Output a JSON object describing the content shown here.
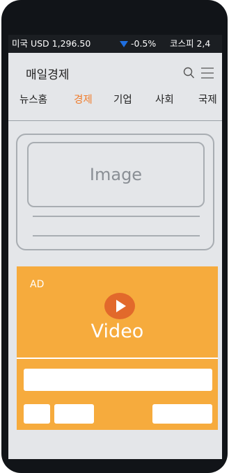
{
  "ticker": {
    "label": "미국 USD 1,296.50",
    "change": "-0.5%",
    "index_label": "코스피 2,4"
  },
  "header": {
    "title": "매일경제"
  },
  "nav": {
    "items": [
      {
        "label": "뉴스홈"
      },
      {
        "label": "경제"
      },
      {
        "label": "기업"
      },
      {
        "label": "사회"
      },
      {
        "label": "국제"
      }
    ],
    "active": "경제"
  },
  "article": {
    "image_placeholder": "Image"
  },
  "ad": {
    "label": "AD",
    "video_label": "Video"
  },
  "colors": {
    "accent": "#f07c2c",
    "ad_background": "#f6ab3d",
    "play_button": "#e2692b",
    "down_indicator": "#1f6fe0"
  },
  "icons": [
    "search-icon",
    "menu-icon",
    "down-triangle-icon",
    "play-icon"
  ]
}
